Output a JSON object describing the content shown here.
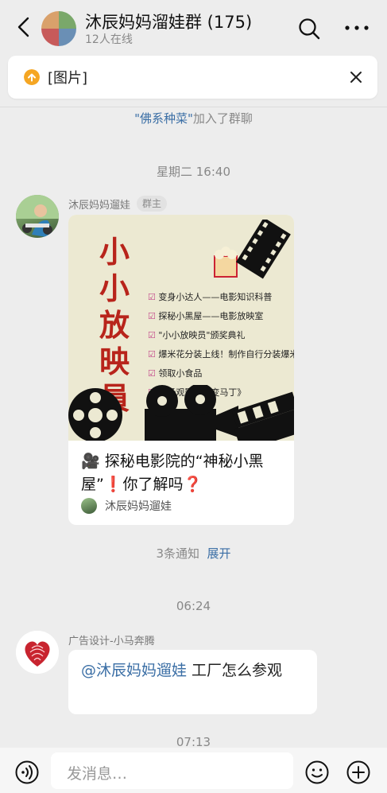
{
  "header": {
    "title": "沐辰妈妈溜娃群 (175)",
    "subtitle": "12人在线"
  },
  "pinned": {
    "text": "[图片]"
  },
  "system": {
    "join_name": "\"佛系种菜\"",
    "join_suffix": "加入了群聊"
  },
  "timestamps": [
    "星期二 16:40",
    "06:24",
    "07:13"
  ],
  "message1": {
    "sender": "沐辰妈妈遛娃",
    "badge": "群主",
    "poster_title": "小小放映員",
    "poster_items": [
      "变身小达人——电影知识科普",
      "探秘小黑屋——电影放映室",
      "\"小小放映员\"颁奖典礼",
      "爆米花分装上线！制作自行分装爆米",
      "领取小食品",
      "入场观影《百变马丁》"
    ],
    "card_title": "🎥 探秘电影院的“神秘小黑屋”❗你了解吗❓",
    "card_source": "沐辰妈妈遛娃"
  },
  "notice": {
    "text": "3条通知",
    "expand": "展开"
  },
  "message2": {
    "sender": "广告设计-小马奔腾",
    "mention": "@沐辰妈妈遛娃",
    "text": " 工厂怎么参观"
  },
  "input": {
    "placeholder": "发消息…"
  },
  "icons": {
    "back": "chevron-left-icon",
    "search": "search-icon",
    "more": "more-icon",
    "pin": "pin-icon",
    "close": "close-icon",
    "voice": "voice-icon",
    "emoji": "emoji-icon",
    "plus": "plus-icon"
  },
  "colors": {
    "link": "#3a6ea5",
    "poster_red": "#b8241b",
    "pin_orange": "#f5a623"
  }
}
